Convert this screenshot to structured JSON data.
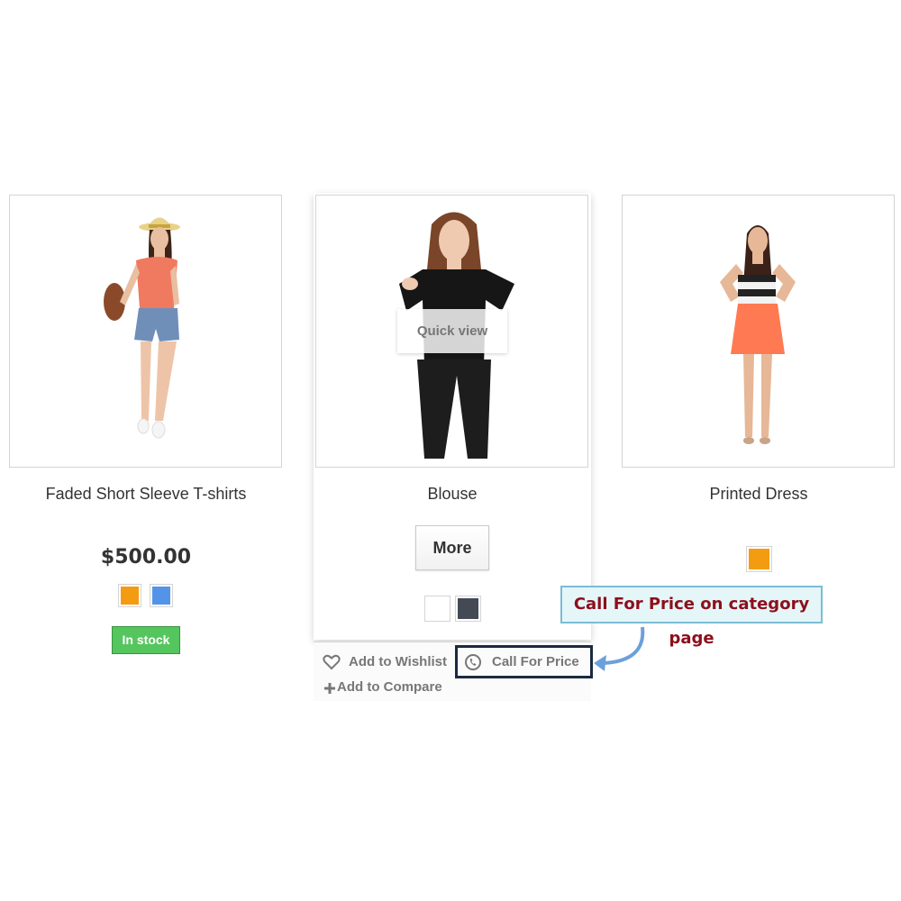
{
  "products": [
    {
      "title": "Faded Short Sleeve T-shirts",
      "price": "$500.00",
      "swatches": [
        "#f39c12",
        "#5494e8"
      ],
      "stock": "In stock",
      "image": "woman-in-hat-coral-top-denim-shorts"
    },
    {
      "title": "Blouse",
      "quick_view": "Quick view",
      "more": "More",
      "swatches": [
        "#ffffff",
        "#434a54"
      ],
      "wishlist": "Add to Wishlist",
      "call_for_price": "Call For Price",
      "compare": "Add to Compare",
      "image": "woman-in-black-blouse"
    },
    {
      "title": "Printed Dress",
      "swatches": [
        "#f39c12"
      ],
      "image": "woman-in-striped-top-orange-skirt"
    }
  ],
  "annotation": {
    "text": "Call For Price on category page",
    "color": "#8c0f1c",
    "arrow_color": "#6ca0dc"
  }
}
